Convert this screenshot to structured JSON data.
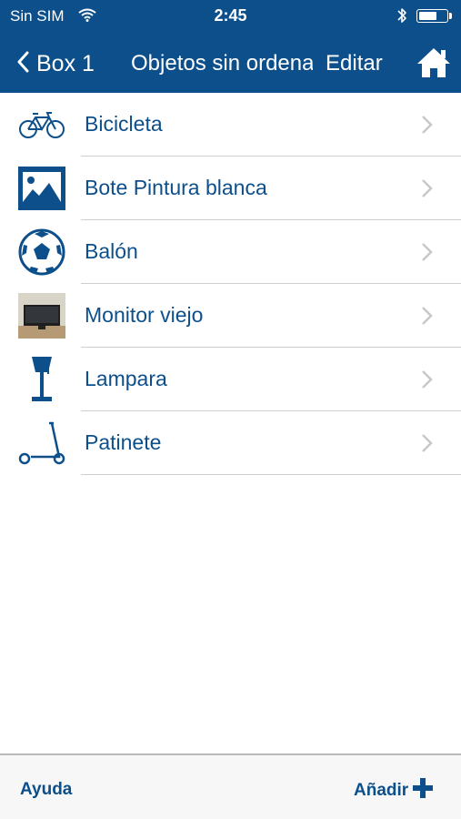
{
  "status_bar": {
    "carrier": "Sin SIM",
    "time": "2:45"
  },
  "nav": {
    "back_label": "Box 1",
    "title": "Objetos sin ordenar",
    "edit_label": "Editar"
  },
  "items": [
    {
      "label": "Bicicleta",
      "icon": "bicycle-icon"
    },
    {
      "label": "Bote Pintura blanca",
      "icon": "image-placeholder-icon"
    },
    {
      "label": "Balón",
      "icon": "soccer-ball-icon"
    },
    {
      "label": "Monitor viejo",
      "icon": "monitor-photo-thumbnail"
    },
    {
      "label": "Lampara",
      "icon": "lamp-icon"
    },
    {
      "label": "Patinete",
      "icon": "scooter-icon"
    }
  ],
  "toolbar": {
    "help_label": "Ayuda",
    "add_label": "Añadir"
  },
  "colors": {
    "brand": "#0c4f8b",
    "toolbar_bg": "#f7f7f7",
    "divider": "#cfcfcf",
    "chevron": "#c7c7cc"
  }
}
